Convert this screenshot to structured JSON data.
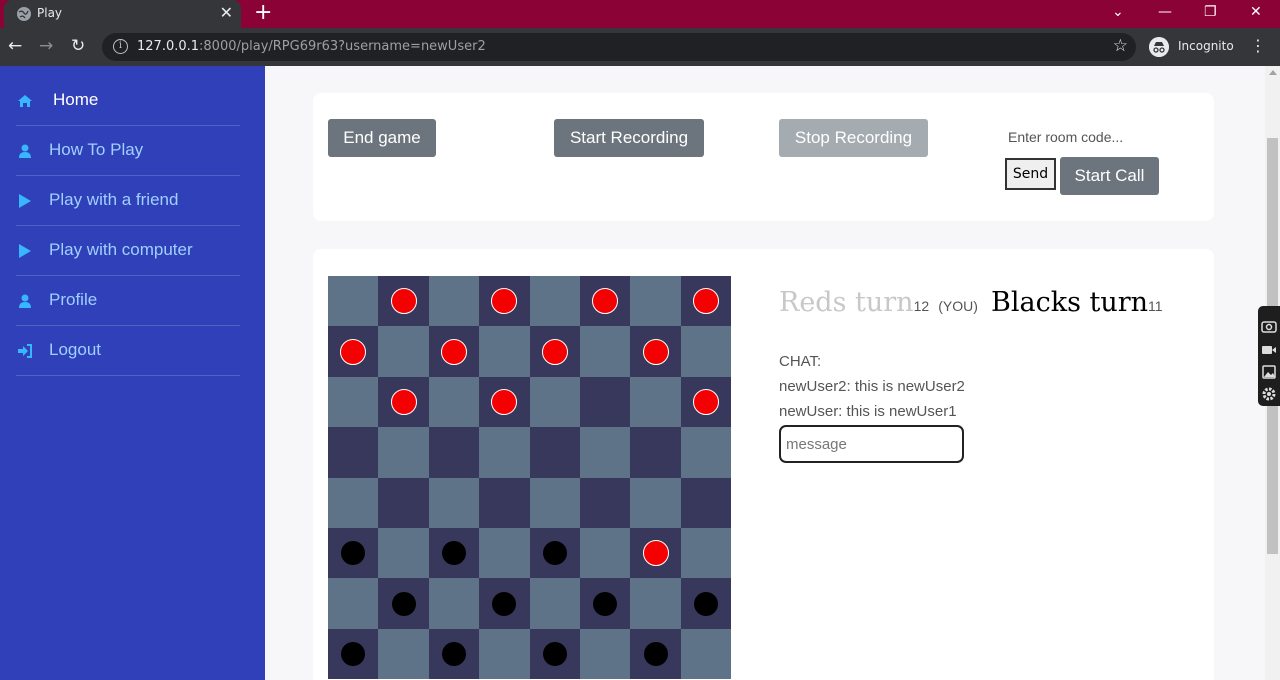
{
  "browser": {
    "tab_title": "Play",
    "new_tab_label": "+",
    "url_host": "127.0.0.1",
    "url_rest": ":8000/play/RPG69r63?username=newUser2",
    "incognito_label": "Incognito",
    "icons": [
      "globe-icon",
      "close-icon",
      "back-icon",
      "forward-icon",
      "reload-icon",
      "info-icon",
      "star-icon",
      "incognito-icon",
      "kebab-menu-icon",
      "minimize-icon",
      "restore-icon"
    ]
  },
  "sidebar": {
    "background": "#3040b8",
    "items": [
      {
        "label": "Home",
        "icon": "home-icon",
        "active": true
      },
      {
        "label": "How To Play",
        "icon": "user-icon",
        "active": false
      },
      {
        "label": "Play with a friend",
        "icon": "play-icon",
        "active": false
      },
      {
        "label": "Play with computer",
        "icon": "play-icon",
        "active": false
      },
      {
        "label": "Profile",
        "icon": "user-icon",
        "active": false
      },
      {
        "label": "Logout",
        "icon": "logout-icon",
        "active": false
      }
    ]
  },
  "controls": {
    "end_game": "End game",
    "start_recording": "Start Recording",
    "stop_recording": "Stop Recording",
    "room_placeholder": "Enter room code...",
    "send": "Send",
    "start_call": "Start Call"
  },
  "game": {
    "board": {
      "light_color": "#5f7388",
      "dark_color": "#37385c",
      "red_pieces": [
        [
          0,
          1
        ],
        [
          0,
          3
        ],
        [
          0,
          5
        ],
        [
          0,
          7
        ],
        [
          1,
          0
        ],
        [
          1,
          2
        ],
        [
          1,
          4
        ],
        [
          1,
          6
        ],
        [
          2,
          1
        ],
        [
          2,
          3
        ],
        [
          2,
          7
        ],
        [
          5,
          6
        ]
      ],
      "black_pieces": [
        [
          5,
          0
        ],
        [
          5,
          2
        ],
        [
          5,
          4
        ],
        [
          6,
          1
        ],
        [
          6,
          3
        ],
        [
          6,
          5
        ],
        [
          6,
          7
        ],
        [
          7,
          0
        ],
        [
          7,
          2
        ],
        [
          7,
          4
        ],
        [
          7,
          6
        ]
      ]
    },
    "reds_turn_label": "Reds turn",
    "reds_count": "12",
    "you_label": "(YOU)",
    "blacks_turn_label": "Blacks turn",
    "blacks_count": "11"
  },
  "chat": {
    "title": "CHAT:",
    "messages": [
      "newUser2: this is newUser2",
      "newUser: this is newUser1"
    ],
    "input_placeholder": "message"
  },
  "extension_panel": {
    "icons": [
      "screenshot-icon",
      "video-icon",
      "gallery-icon",
      "settings-icon"
    ]
  }
}
